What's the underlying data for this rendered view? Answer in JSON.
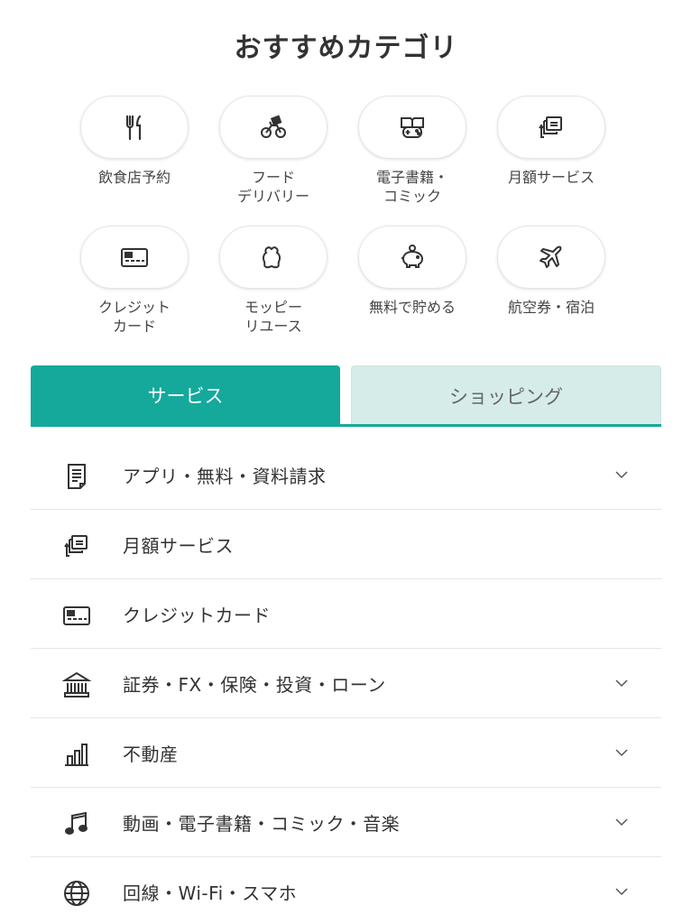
{
  "page": {
    "title": "おすすめカテゴリ"
  },
  "categories": [
    {
      "label": "飲食店予約",
      "icon": "fork-knife-icon"
    },
    {
      "label": "フード\nデリバリー",
      "icon": "bicycle-delivery-icon"
    },
    {
      "label": "電子書籍・\nコミック",
      "icon": "book-gamepad-icon"
    },
    {
      "label": "月額サービス",
      "icon": "subscription-icon"
    },
    {
      "label": "クレジット\nカード",
      "icon": "credit-card-icon"
    },
    {
      "label": "モッピー\nリユース",
      "icon": "bag-icon"
    },
    {
      "label": "無料で貯める",
      "icon": "piggy-bank-icon"
    },
    {
      "label": "航空券・宿泊",
      "icon": "airplane-icon"
    }
  ],
  "tabs": {
    "active": "サービス",
    "inactive": "ショッピング"
  },
  "list": [
    {
      "label": "アプリ・無料・資料請求",
      "icon": "document-icon",
      "expandable": true
    },
    {
      "label": "月額サービス",
      "icon": "subscription-icon",
      "expandable": false
    },
    {
      "label": "クレジットカード",
      "icon": "credit-card-icon",
      "expandable": false
    },
    {
      "label": "証券・FX・保険・投資・ローン",
      "icon": "bank-icon",
      "expandable": true
    },
    {
      "label": "不動産",
      "icon": "bar-chart-icon",
      "expandable": true
    },
    {
      "label": "動画・電子書籍・コミック・音楽",
      "icon": "music-note-icon",
      "expandable": true
    },
    {
      "label": "回線・Wi-Fi・スマホ",
      "icon": "globe-icon",
      "expandable": true
    }
  ],
  "colors": {
    "accent": "#15a99b",
    "tab_inactive_bg": "#d6ece9",
    "text": "#333333"
  }
}
